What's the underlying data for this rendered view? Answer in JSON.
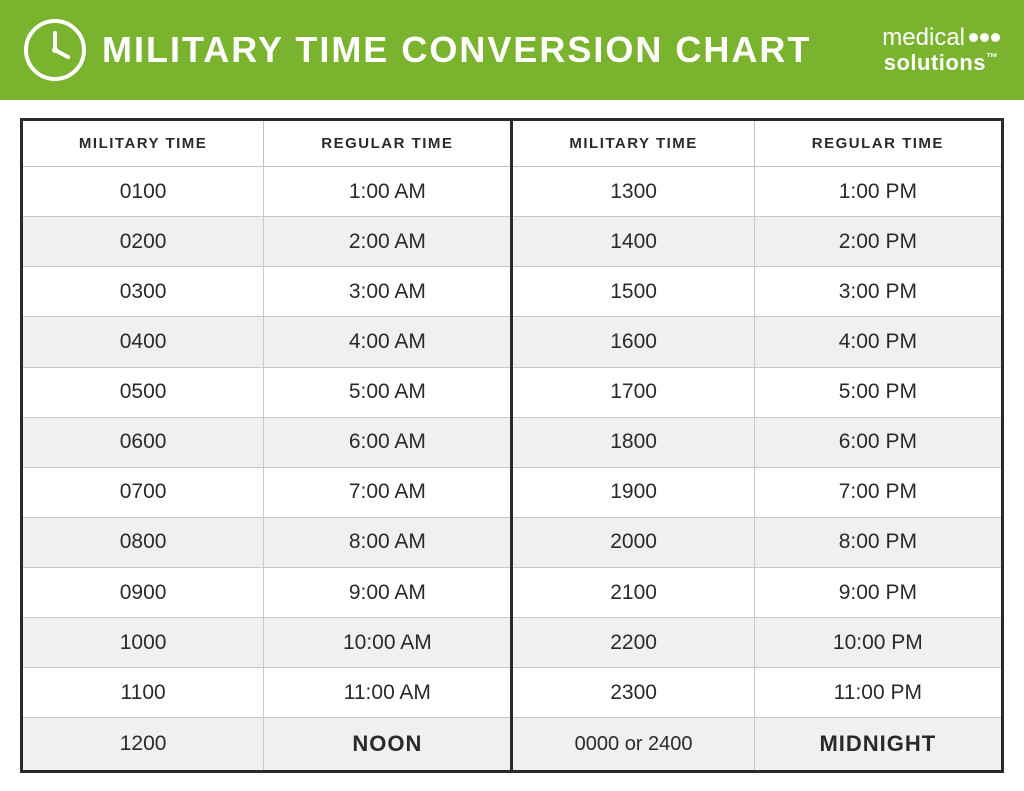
{
  "header": {
    "title": "MILITARY TIME CONVERSION CHART",
    "brand_medical": "medical",
    "brand_solutions": "solutions",
    "brand_tm": "™"
  },
  "table": {
    "columns": [
      "MILITARY TIME",
      "REGULAR TIME",
      "MILITARY TIME",
      "REGULAR TIME"
    ],
    "rows": [
      {
        "mil1": "0100",
        "reg1": "1:00 AM",
        "mil2": "1300",
        "reg2": "1:00 PM"
      },
      {
        "mil1": "0200",
        "reg1": "2:00 AM",
        "mil2": "1400",
        "reg2": "2:00 PM"
      },
      {
        "mil1": "0300",
        "reg1": "3:00 AM",
        "mil2": "1500",
        "reg2": "3:00 PM"
      },
      {
        "mil1": "0400",
        "reg1": "4:00 AM",
        "mil2": "1600",
        "reg2": "4:00 PM"
      },
      {
        "mil1": "0500",
        "reg1": "5:00 AM",
        "mil2": "1700",
        "reg2": "5:00 PM"
      },
      {
        "mil1": "0600",
        "reg1": "6:00 AM",
        "mil2": "1800",
        "reg2": "6:00 PM"
      },
      {
        "mil1": "0700",
        "reg1": "7:00 AM",
        "mil2": "1900",
        "reg2": "7:00 PM"
      },
      {
        "mil1": "0800",
        "reg1": "8:00 AM",
        "mil2": "2000",
        "reg2": "8:00 PM"
      },
      {
        "mil1": "0900",
        "reg1": "9:00 AM",
        "mil2": "2100",
        "reg2": "9:00 PM"
      },
      {
        "mil1": "1000",
        "reg1": "10:00 AM",
        "mil2": "2200",
        "reg2": "10:00 PM"
      },
      {
        "mil1": "1100",
        "reg1": "11:00 AM",
        "mil2": "2300",
        "reg2": "11:00 PM"
      },
      {
        "mil1": "1200",
        "reg1": "NOON",
        "mil2": "0000 or 2400",
        "reg2": "MIDNIGHT"
      }
    ]
  },
  "colors": {
    "header_bg": "#7ab32e",
    "table_border": "#2a2a2a",
    "row_even_bg": "#f0f0f0",
    "row_odd_bg": "#ffffff",
    "text_color": "#2a2a2a",
    "white": "#ffffff"
  }
}
